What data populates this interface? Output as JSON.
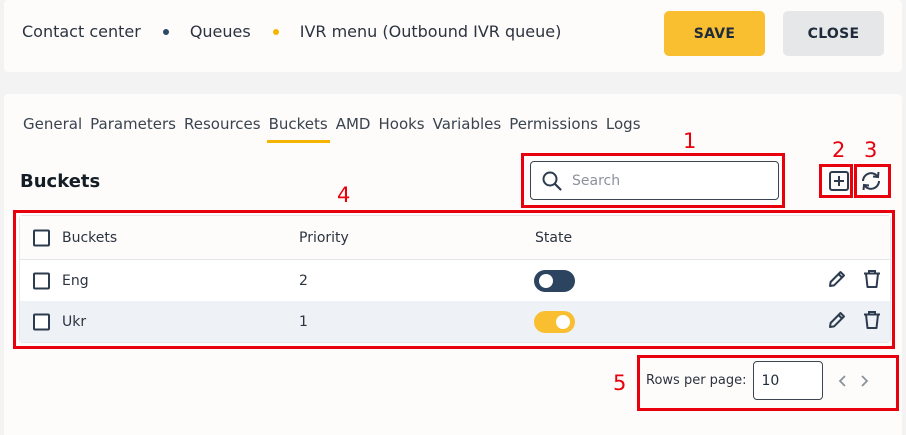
{
  "breadcrumb": [
    "Contact center",
    "Queues",
    "IVR menu (Outbound IVR queue)"
  ],
  "buttons": {
    "save": "SAVE",
    "close": "CLOSE"
  },
  "tabs": [
    "General",
    "Parameters",
    "Resources",
    "Buckets",
    "AMD",
    "Hooks",
    "Variables",
    "Permissions",
    "Logs"
  ],
  "active_tab": "Buckets",
  "section_title": "Buckets",
  "search": {
    "placeholder": "Search",
    "value": ""
  },
  "table": {
    "columns": [
      "Buckets",
      "Priority",
      "State"
    ],
    "rows": [
      {
        "name": "Eng",
        "priority": "2",
        "state": "off"
      },
      {
        "name": "Ukr",
        "priority": "1",
        "state": "on"
      }
    ]
  },
  "pagination": {
    "label": "Rows per page:",
    "value": "10"
  },
  "annotations": [
    "1",
    "2",
    "3",
    "4",
    "5"
  ],
  "colors": {
    "accent": "#f9bf31",
    "toggle_off": "#2c4460",
    "annotation": "#e8000d"
  },
  "icons": [
    "search-icon",
    "add-icon",
    "refresh-icon",
    "edit-icon",
    "delete-icon",
    "chevron-left-icon",
    "chevron-right-icon"
  ]
}
